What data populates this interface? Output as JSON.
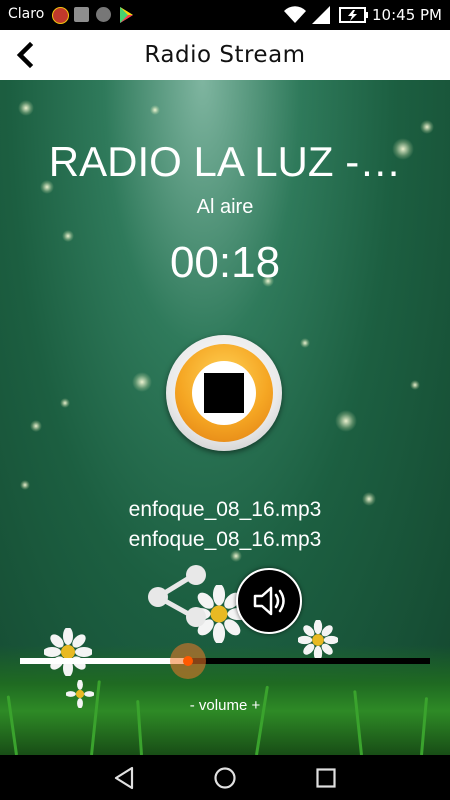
{
  "status_bar": {
    "carrier": "Claro",
    "notification_icons": [
      "radio-app-icon",
      "gallery-icon",
      "download-icon",
      "play-store-icon"
    ],
    "wifi_icon": "wifi-icon",
    "signal_icon": "signal-icon",
    "battery_icon": "battery-charging-icon",
    "time": "10:45 PM"
  },
  "app_bar": {
    "back_icon": "back-arrow-icon",
    "title": "Radio Stream"
  },
  "player": {
    "station_name": "RADIO LA LUZ -…",
    "status": "Al aire",
    "elapsed": "00:18",
    "control_icon": "stop-icon",
    "track_line_1": "enfoque_08_16.mp3",
    "track_line_2": "enfoque_08_16.mp3",
    "share_icon": "share-icon",
    "volume_icon": "speaker-volume-icon",
    "volume_level": 0.41,
    "volume_label": "- volume +"
  },
  "nav_bar": {
    "back_icon": "nav-back-icon",
    "home_icon": "nav-home-icon",
    "recents_icon": "nav-recents-icon"
  },
  "colors": {
    "accent_orange": "#f5a623",
    "background_green": "#1c5f41",
    "slider_thumb": "#ff5a00"
  }
}
